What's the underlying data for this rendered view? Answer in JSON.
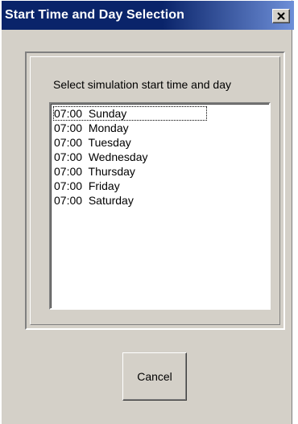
{
  "window": {
    "title": "Start Time and Day Selection"
  },
  "title_bar_buttons": {
    "close_icon": "close-icon"
  },
  "dialog": {
    "prompt": "Select simulation start time and day",
    "list_items": [
      "07:00  Sunday",
      "07:00  Monday",
      "07:00  Tuesday",
      "07:00  Wednesday",
      "07:00  Thursday",
      "07:00  Friday",
      "07:00  Saturday"
    ],
    "focused_item": "07:00  Sunday",
    "cancel_label": "Cancel"
  },
  "colors": {
    "title_bar_start": "#0a246a",
    "title_bar_end": "#6e8fd8",
    "window_face": "#d4d0c8",
    "list_background": "#ffffff"
  }
}
